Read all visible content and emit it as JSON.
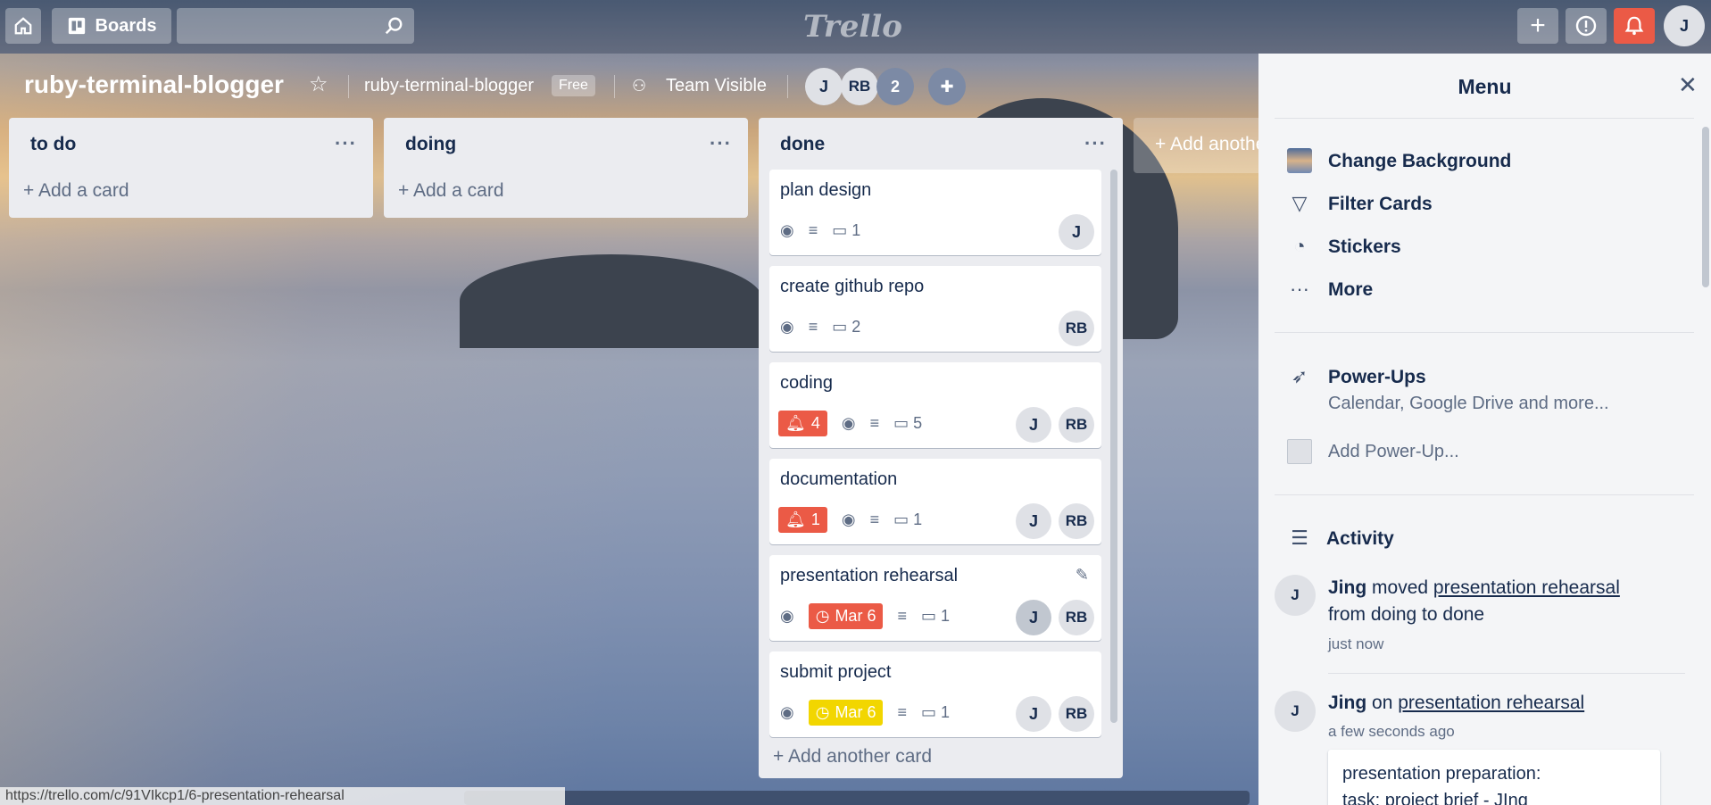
{
  "topbar": {
    "boards_label": "Boards",
    "logo_text": "Trello",
    "user_initial": "J"
  },
  "board": {
    "name": "ruby-terminal-blogger",
    "team_name": "ruby-terminal-blogger",
    "plan_badge": "Free",
    "visibility": "Team Visible",
    "members": [
      "J",
      "RB"
    ],
    "extra_members_count": "2",
    "add_another_list": "+ Add another list"
  },
  "lists": [
    {
      "title": "to do",
      "add_card": "Add a card"
    },
    {
      "title": "doing",
      "add_card": "Add a card"
    },
    {
      "title": "done",
      "add_card": "Add another card",
      "cards": [
        {
          "title": "plan design",
          "comments": "1",
          "members": [
            "J"
          ]
        },
        {
          "title": "create github repo",
          "comments": "2",
          "members": [
            "RB"
          ]
        },
        {
          "title": "coding",
          "notifications": "4",
          "comments": "5",
          "members": [
            "J",
            "RB"
          ]
        },
        {
          "title": "documentation",
          "notifications": "1",
          "comments": "1",
          "members": [
            "J",
            "RB"
          ]
        },
        {
          "title": "presentation rehearsal",
          "due": "Mar 6",
          "comments": "1",
          "members": [
            "J",
            "RB"
          ]
        },
        {
          "title": "submit project",
          "due": "Mar 6",
          "comments": "1",
          "members": [
            "J",
            "RB"
          ]
        }
      ]
    }
  ],
  "menu": {
    "title": "Menu",
    "items": [
      "Change Background",
      "Filter Cards",
      "Stickers",
      "More"
    ],
    "powerups_title": "Power-Ups",
    "powerups_sub": "Calendar, Google Drive and more...",
    "add_powerup": "Add Power-Up...",
    "activity_title": "Activity",
    "activity": [
      {
        "user": "Jing",
        "verb": "moved",
        "link": "presentation rehearsal",
        "detail": "from doing to done",
        "time": "just now"
      },
      {
        "user": "Jing",
        "verb": "on",
        "link": "presentation rehearsal",
        "time": "a few seconds ago",
        "comment_line1": "presentation preparation:",
        "comment_line2": "task: project brief - JIng"
      }
    ]
  },
  "status_url": "https://trello.com/c/91VIkcp1/6-presentation-rehearsal",
  "colors": {
    "red_badge": "#eb5a46",
    "yellow_badge": "#f2d600"
  }
}
